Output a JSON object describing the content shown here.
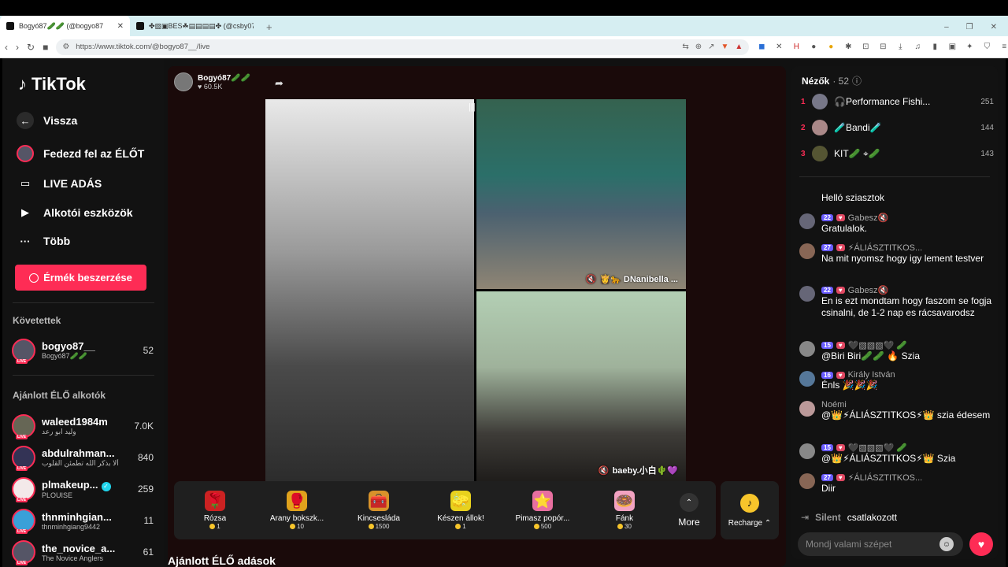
{
  "browser": {
    "tabs": [
      {
        "title": "Bogyó87🥒🥒 (@bogyo87",
        "active": true
      },
      {
        "title": "✤▧▣BES☘︎▤▤▤▤✤ (@csby07",
        "active": false
      }
    ],
    "url": "https://www.tiktok.com/@bogyo87__/live"
  },
  "sidebar": {
    "logo": "TikTok",
    "nav": [
      {
        "label": "Vissza",
        "icon": "back-arrow-icon"
      },
      {
        "label": "Fedezd fel az ÉLŐT",
        "icon": "explore-live-icon"
      },
      {
        "label": "LIVE ADÁS",
        "icon": "camera-icon"
      },
      {
        "label": "Alkotói eszközök",
        "icon": "creator-tools-icon"
      },
      {
        "label": "Több",
        "icon": "more-dots-icon"
      }
    ],
    "coins_button": "Érmék beszerzése",
    "following_heading": "Követettek",
    "following": [
      {
        "name": "bogyo87__",
        "sub": "Bogyó87🥒🥒",
        "count": "52"
      }
    ],
    "recommended_heading": "Ajánlott ÉLŐ alkotók",
    "recommended": [
      {
        "name": "waleed1984m",
        "sub": "وليد ابو رعد",
        "count": "7.0K"
      },
      {
        "name": "abdulrahman...",
        "sub": "ألا بذكر الله تطمئن القلوب",
        "count": "840"
      },
      {
        "name": "plmakeup...",
        "sub": "PLOUISE",
        "count": "259",
        "verified": true
      },
      {
        "name": "thnminhgian...",
        "sub": "thnminhgiang9442",
        "count": "11"
      },
      {
        "name": "the_novice_a...",
        "sub": "The Novice Anglers",
        "count": "61"
      }
    ]
  },
  "stream": {
    "host_name": "Bogyó87🥒🥒",
    "likes": "60.5K",
    "guest1_label": "👸🐆 DNanibella ...",
    "guest2_label": "baeby.小白🌵💜"
  },
  "gifts": [
    {
      "name": "Rózsa",
      "price": "1",
      "icon": "🌹",
      "bg": "#c22"
    },
    {
      "name": "Arany bokszk...",
      "price": "10",
      "icon": "🥊",
      "bg": "#e0a21c"
    },
    {
      "name": "Kincsesláda",
      "price": "1500",
      "icon": "🧰",
      "bg": "#d8922a"
    },
    {
      "name": "Készen állok!",
      "price": "1",
      "icon": "🧽",
      "bg": "#e8d11d"
    },
    {
      "name": "Pimasz popór...",
      "price": "500",
      "icon": "⭐",
      "bg": "#e86fa0"
    },
    {
      "name": "Fánk",
      "price": "30",
      "icon": "🍩",
      "bg": "#f2a2c1"
    }
  ],
  "more_label": "More",
  "recharge_label": "Recharge ⌃",
  "bottom_heading": "Ajánlott ÉLŐ adások",
  "chat": {
    "viewers_title": "Nézők",
    "viewers_count": "· 52",
    "top_viewers": [
      {
        "rank": "1",
        "name": "🎧Performance Fishi...",
        "score": "251"
      },
      {
        "rank": "2",
        "name": "🧪Bandi🧪",
        "score": "144"
      },
      {
        "rank": "3",
        "name": "KIT🥒 ⌖🥒",
        "score": "143"
      }
    ],
    "messages": [
      {
        "user": "",
        "level": "",
        "text": "Helló sziasztok"
      },
      {
        "user": "Gabesz🔇",
        "level": "22",
        "text": "Gratulalok."
      },
      {
        "user": "⚡ÁLIÁSZTITKOS...",
        "level": "27",
        "text": "Na mit nyomsz hogy igy lement testver"
      },
      {
        "user": "Gabesz🔇",
        "level": "22",
        "text": "En is ezt mondtam hogy faszom se fogja csinalni, de 1-2 nap es rácsavarodsz"
      },
      {
        "user": "🖤▧▧▧🖤 🥒",
        "level": "15",
        "text": "@Biri Biri🥒🥒 🔥 Szia"
      },
      {
        "user": "Király István",
        "level": "16",
        "text": "Énls 🎉🎉🎉"
      },
      {
        "user": "Noémi",
        "level": "",
        "text": "@👑⚡ÁLIÁSZTITKOS⚡👑 szia édesem"
      },
      {
        "user": "🖤▧▧▧🖤 🥒",
        "level": "15",
        "text": "@👑⚡ÁLIÁSZTITKOS⚡👑 Szia"
      },
      {
        "user": "⚡ÁLIÁSZTITKOS...",
        "level": "27",
        "text": "Diir"
      }
    ],
    "joined_user": "Silent",
    "joined_text": "csatlakozott",
    "input_placeholder": "Mondj valami szépet"
  }
}
